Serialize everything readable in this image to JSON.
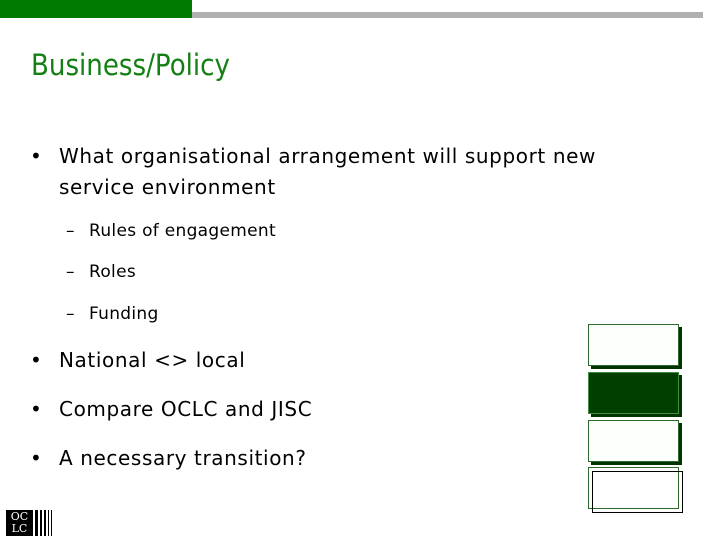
{
  "slide": {
    "title": "Business/Policy",
    "bullets": [
      {
        "text_line1": "What organisational arrangement will support new",
        "text_line2": "service environment",
        "sub_items": [
          "Rules of engagement",
          "Roles",
          "Funding"
        ]
      },
      {
        "text": "National <> local"
      },
      {
        "text": "Compare OCLC and JISC"
      },
      {
        "text": "A necessary transition?"
      }
    ],
    "bullet_glyph": "•",
    "sub_bullet_glyph": "–"
  },
  "logo": {
    "line1": "OC",
    "line2": "LC"
  },
  "colors": {
    "accent_green": "#007a00",
    "title_green": "#148014",
    "rule_gray": "#b0b0b0",
    "dark_box": "#003f00"
  }
}
